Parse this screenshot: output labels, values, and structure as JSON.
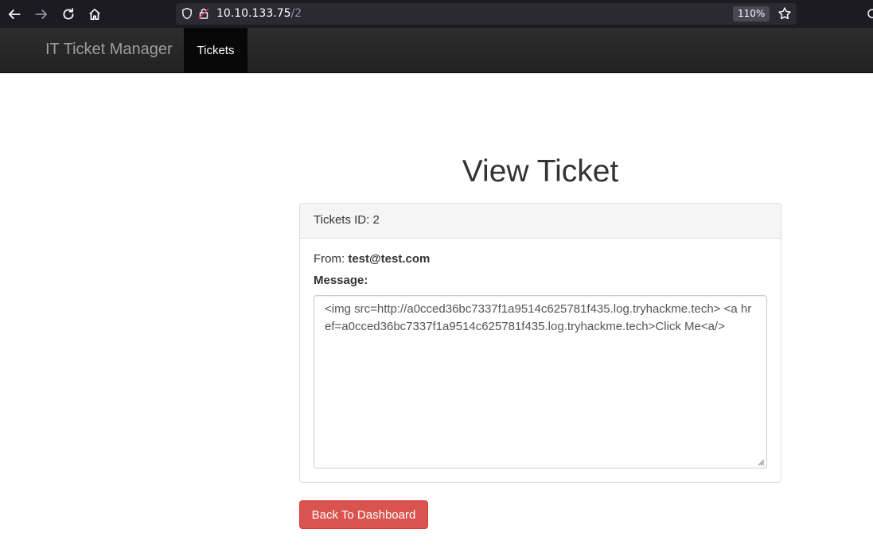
{
  "browser": {
    "url_host": "10.10.133.75",
    "url_path": "/2",
    "zoom": "110%"
  },
  "navbar": {
    "brand": "IT Ticket Manager",
    "tab_label": "Tickets"
  },
  "ticket": {
    "page_title": "View Ticket",
    "id_label": "Tickets ID: 2",
    "from_label": "From: ",
    "from_email": "test@test.com",
    "message_label": "Message:",
    "message_text": "<img src=http://a0cced36bc7337f1a9514c625781f435.log.tryhackme.tech> <a href=a0cced36bc7337f1a9514c625781f435.log.tryhackme.tech>Click Me<a/>"
  },
  "actions": {
    "back_label": "Back To Dashboard"
  },
  "colors": {
    "browser_bg": "#1c1b22",
    "navbar_bg": "#222222",
    "danger": "#d9534f"
  }
}
